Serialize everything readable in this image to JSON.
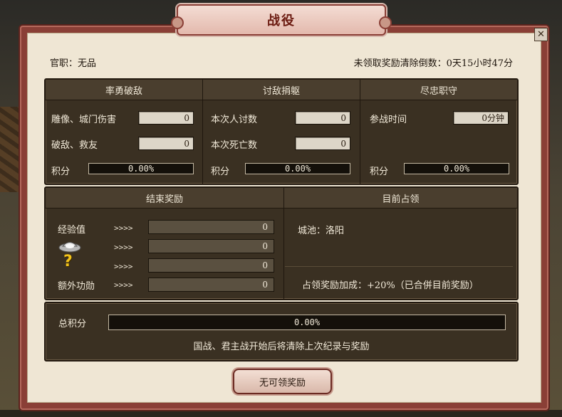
{
  "window": {
    "title": "战役",
    "close_symbol": "✕"
  },
  "header": {
    "rank_label": "官职：无品",
    "countdown_label": "未领取奖励清除倒数：0天15小时47分"
  },
  "columns": [
    {
      "title": "率勇破敌",
      "rows": [
        {
          "label": "雕像、城门伤害",
          "value": "0"
        },
        {
          "label": "破敌、救友",
          "value": "0"
        }
      ],
      "score_label": "积分",
      "score_percent": "0.00%"
    },
    {
      "title": "讨敌捐躯",
      "rows": [
        {
          "label": "本次人讨数",
          "value": "0"
        },
        {
          "label": "本次死亡数",
          "value": "0"
        }
      ],
      "score_label": "积分",
      "score_percent": "0.00%"
    },
    {
      "title": "尽忠职守",
      "rows": [
        {
          "label": "参战时间",
          "value": "0分钟"
        }
      ],
      "score_label": "积分",
      "score_percent": "0.00%"
    }
  ],
  "rewards": {
    "title": "结束奖励",
    "arrows": ">>>>",
    "items": [
      {
        "label": "经验值",
        "icon": "",
        "value": "0"
      },
      {
        "label": "",
        "icon": "silver-ingot-icon",
        "value": "0"
      },
      {
        "label": "",
        "icon": "question-mark-icon",
        "value": "0"
      },
      {
        "label": "额外功勋",
        "icon": "",
        "value": "0"
      }
    ]
  },
  "occupation": {
    "title": "目前占领",
    "city": "城池：洛阳",
    "bonus": "占领奖励加成：+20%（已合併目前奖励）"
  },
  "total": {
    "label": "总积分",
    "percent": "0.00%",
    "notice": "国战、君主战开始后将清除上次纪录与奖励"
  },
  "claim_button": "无可领奖励",
  "colors": {
    "frame": "#8a3f36",
    "parchment": "#efe6d4",
    "panel": "#3a3022",
    "title_text": "#6b1a10",
    "question_mark": "#f2c21a"
  }
}
